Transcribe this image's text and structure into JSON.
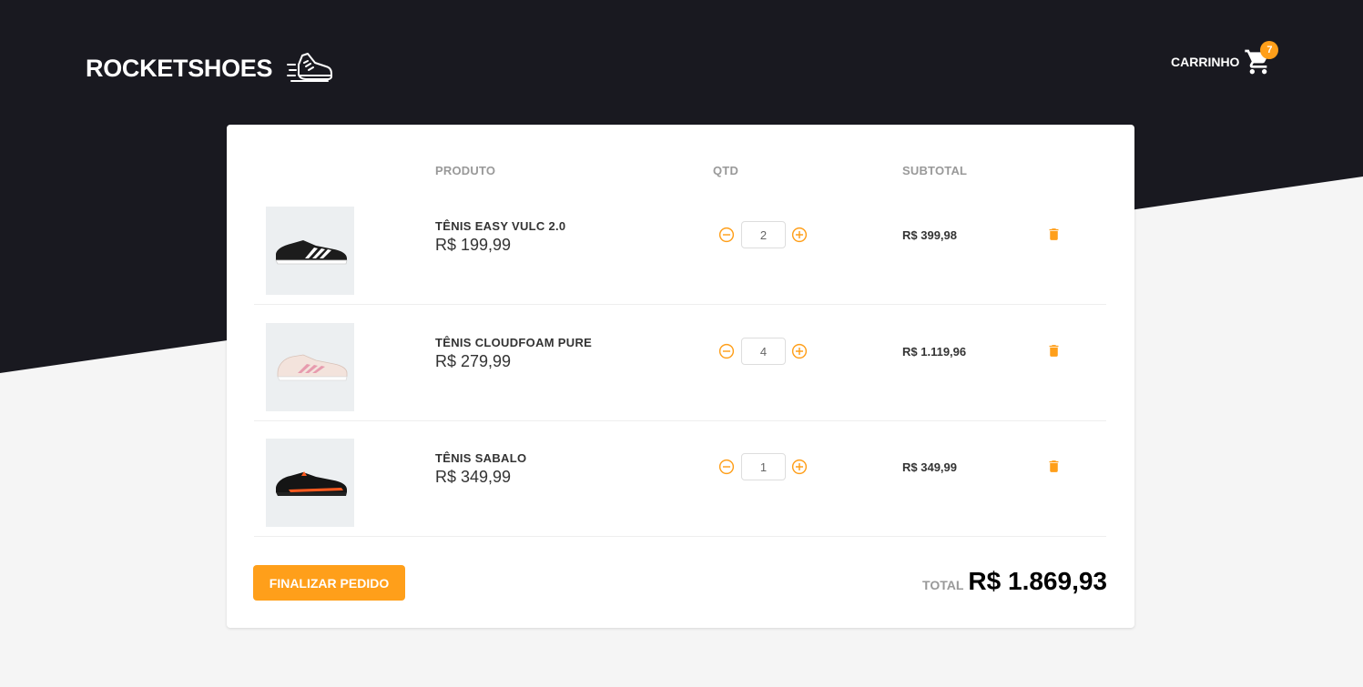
{
  "header": {
    "logo_text": "ROCKETSHOES",
    "logo_icon": "sneaker-icon",
    "cart_label": "CARRINHO",
    "cart_icon": "shopping-cart-icon",
    "cart_count": "7"
  },
  "table": {
    "col_product": "PRODUTO",
    "col_qty": "QTD",
    "col_subtotal": "SUBTOTAL"
  },
  "items": [
    {
      "name": "TÊNIS EASY VULC 2.0",
      "price": "R$ 199,99",
      "quantity": "2",
      "subtotal": "R$ 399,98",
      "image_icon": "black-white-sneaker"
    },
    {
      "name": "TÊNIS CLOUDFOAM PURE",
      "price": "R$ 279,99",
      "quantity": "4",
      "subtotal": "R$ 1.119,96",
      "image_icon": "pink-sneaker"
    },
    {
      "name": "TÊNIS SABALO",
      "price": "R$ 349,99",
      "quantity": "1",
      "subtotal": "R$ 349,99",
      "image_icon": "black-orange-sneaker"
    }
  ],
  "footer": {
    "checkout_label": "FINALIZAR PEDIDO",
    "total_label": "TOTAL",
    "total_value": "R$ 1.869,93"
  },
  "colors": {
    "dark_bg": "#191920",
    "accent": "#ff9f1a",
    "page_bg": "#f5f5f5"
  }
}
